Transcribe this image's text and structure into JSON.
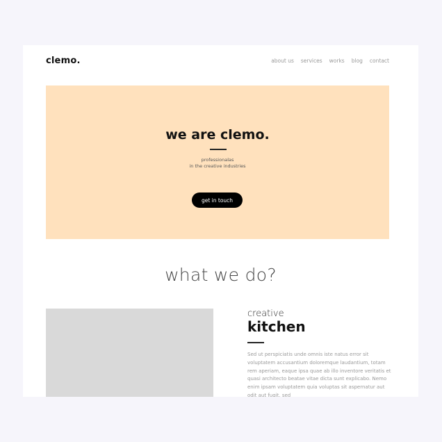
{
  "brand": {
    "logo": "clemo."
  },
  "nav": {
    "items": [
      {
        "label": "about us"
      },
      {
        "label": "services"
      },
      {
        "label": "works"
      },
      {
        "label": "blog"
      },
      {
        "label": "contact"
      }
    ]
  },
  "hero": {
    "title": "we are clemo.",
    "subtitle_line1": "professionalas",
    "subtitle_line2": "in the creative industries",
    "cta_label": "get in touch",
    "background_color": "#ffe1bd"
  },
  "what_we_do": {
    "title": "what we do?"
  },
  "feature": {
    "kicker": "creative",
    "title": "kitchen",
    "body": "Sed ut perspiciatis unde omnis iste natus error sit voluptatem accusantium doloremque laudantium, totam rem aperiam, eaque ipsa quae ab illo inventore veritatis et quasi architecto beatae vitae dicta sunt explicabo. Nemo enim ipsam voluptatem quia voluptas sit aspernatur aut odit aut fugit, sed"
  }
}
